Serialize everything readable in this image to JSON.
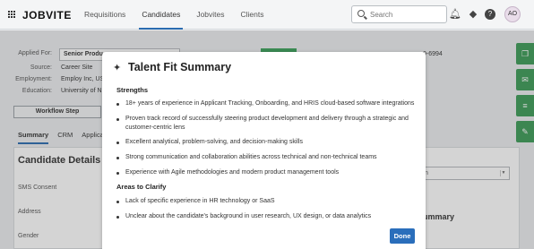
{
  "header": {
    "logo": "JOBVITE",
    "nav": [
      "Requisitions",
      "Candidates",
      "Jobvites",
      "Clients"
    ],
    "search_placeholder": "Search",
    "avatar_initials": "AO",
    "accent_color": "#2b6cb0"
  },
  "candidate": {
    "applied_for_label": "Applied For:",
    "applied_for_value": "Senior Produ",
    "source_label": "Source:",
    "source_value": "Career Site",
    "employment_label": "Employment:",
    "employment_value": "Employ Inc, US",
    "education_label": "Education:",
    "education_value": "University of N",
    "phone_partial": "0-6994",
    "workflow_button": "Workflow Step",
    "tabs": [
      "Summary",
      "CRM",
      "Applica"
    ],
    "details_title": "Candidate Details",
    "fields": [
      "SMS Consent",
      "Address",
      "Gender"
    ],
    "right_title": "n",
    "right_select": "ition",
    "right_title2": "Summary"
  },
  "modal": {
    "title": "Talent Fit Summary",
    "strengths_label": "Strengths",
    "strengths": [
      "18+ years of experience in Applicant Tracking, Onboarding, and HRIS cloud-based software integrations",
      "Proven track record of successfully steering product development and delivery through a strategic and customer-centric lens",
      "Excellent analytical, problem-solving, and decision-making skills",
      "Strong communication and collaboration abilities across technical and non-technical teams",
      "Experience with Agile methodologies and modern product management tools"
    ],
    "clarify_label": "Areas to Clarify",
    "clarify": [
      "Lack of specific experience in HR technology or SaaS",
      "Unclear about the candidate's background in user research, UX design, or data analytics"
    ],
    "done_label": "Done",
    "done_color": "#2a6ebb"
  }
}
